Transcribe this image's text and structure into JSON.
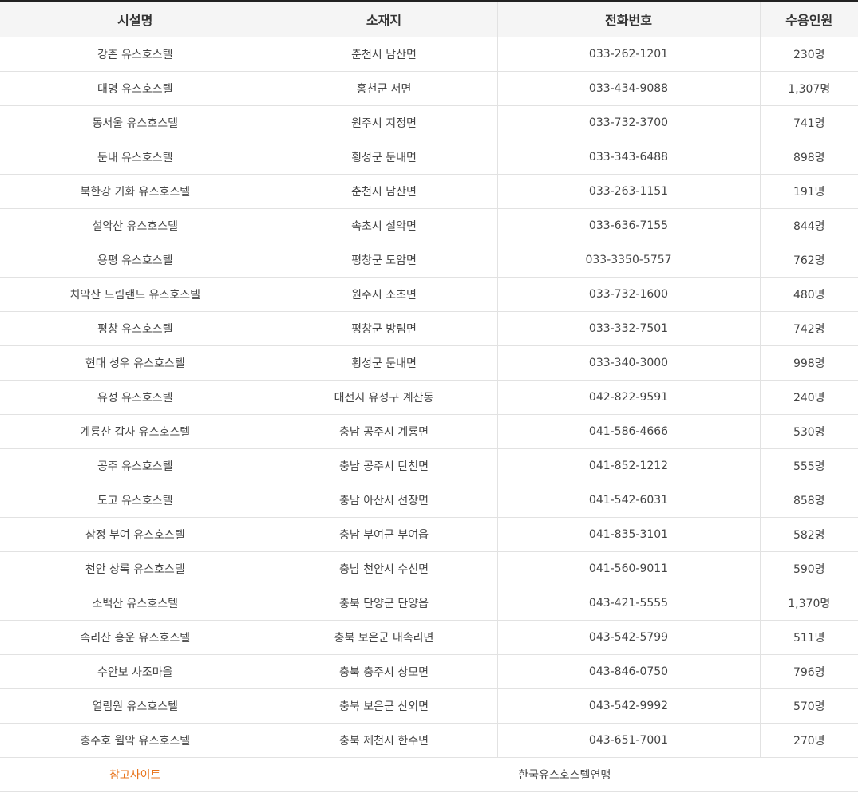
{
  "header": {
    "name": "시설명",
    "location": "소재지",
    "phone": "전화번호",
    "capacity": "수용인원"
  },
  "rows": [
    {
      "name": "강촌 유스호스텔",
      "location": "춘천시 남산면",
      "phone": "033-262-1201",
      "capacity": "230명"
    },
    {
      "name": "대명 유스호스텔",
      "location": "홍천군 서면",
      "phone": "033-434-9088",
      "capacity": "1,307명"
    },
    {
      "name": "동서울 유스호스텔",
      "location": "원주시 지정면",
      "phone": "033-732-3700",
      "capacity": "741명"
    },
    {
      "name": "둔내 유스호스텔",
      "location": "횡성군 둔내면",
      "phone": "033-343-6488",
      "capacity": "898명"
    },
    {
      "name": "북한강 기화 유스호스텔",
      "location": "춘천시 남산면",
      "phone": "033-263-1151",
      "capacity": "191명"
    },
    {
      "name": "설악산 유스호스텔",
      "location": "속초시 설악면",
      "phone": "033-636-7155",
      "capacity": "844명"
    },
    {
      "name": "용평 유스호스텔",
      "location": "평창군 도암면",
      "phone": "033-3350-5757",
      "capacity": "762명"
    },
    {
      "name": "치악산 드림랜드 유스호스텔",
      "location": "원주시 소초면",
      "phone": "033-732-1600",
      "capacity": "480명"
    },
    {
      "name": "평창 유스호스텔",
      "location": "평창군 방림면",
      "phone": "033-332-7501",
      "capacity": "742명"
    },
    {
      "name": "현대 성우 유스호스텔",
      "location": "횡성군 둔내면",
      "phone": "033-340-3000",
      "capacity": "998명"
    },
    {
      "name": "유성 유스호스텔",
      "location": "대전시 유성구 계산동",
      "phone": "042-822-9591",
      "capacity": "240명"
    },
    {
      "name": "계룡산 갑사 유스호스텔",
      "location": "충남 공주시 계룡면",
      "phone": "041-586-4666",
      "capacity": "530명"
    },
    {
      "name": "공주 유스호스텔",
      "location": "충남 공주시 탄천면",
      "phone": "041-852-1212",
      "capacity": "555명"
    },
    {
      "name": "도고 유스호스텔",
      "location": "충남 아산시 선장면",
      "phone": "041-542-6031",
      "capacity": "858명"
    },
    {
      "name": "삼정 부여 유스호스텔",
      "location": "충남 부여군 부여읍",
      "phone": "041-835-3101",
      "capacity": "582명"
    },
    {
      "name": "천안 상록 유스호스텔",
      "location": "충남 천안시 수신면",
      "phone": "041-560-9011",
      "capacity": "590명"
    },
    {
      "name": "소백산 유스호스텔",
      "location": "충북 단양군 단양읍",
      "phone": "043-421-5555",
      "capacity": "1,370명"
    },
    {
      "name": "속리산 흥운 유스호스텔",
      "location": "충북 보은군 내속리면",
      "phone": "043-542-5799",
      "capacity": "511명"
    },
    {
      "name": "수안보 사조마을",
      "location": "충북 충주시 상모면",
      "phone": "043-846-0750",
      "capacity": "796명"
    },
    {
      "name": "열림원 유스호스텔",
      "location": "충북 보은군 산외면",
      "phone": "043-542-9992",
      "capacity": "570명"
    },
    {
      "name": "충주호 월악 유스호스텔",
      "location": "충북 제천시 한수면",
      "phone": "043-651-7001",
      "capacity": "270명"
    }
  ],
  "footer": {
    "label": "참고사이트",
    "value": "한국유스호스텔연맹"
  },
  "colors": {
    "accent": "#e8731a",
    "header_bg": "#f5f5f5",
    "top_border": "#222222"
  }
}
